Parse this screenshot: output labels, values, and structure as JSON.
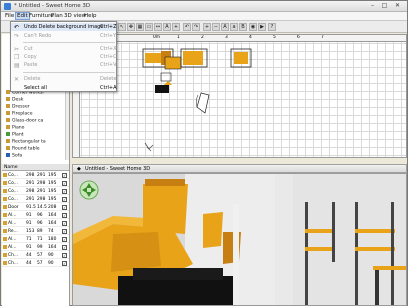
{
  "window": {
    "title": "* Untitled - Sweet Home 3D",
    "min_label": "–",
    "max_label": "□",
    "close_label": "✕"
  },
  "menubar": {
    "items": [
      "File",
      "Edit",
      "Furniture",
      "Plan",
      "3D view",
      "Help"
    ]
  },
  "edit_menu": {
    "items": [
      {
        "label": "Undo Delete background image",
        "shortcut": "Ctrl+Z",
        "enabled": true
      },
      {
        "label": "Can't Redo",
        "shortcut": "Ctrl+Y",
        "enabled": false
      },
      {
        "label": "Cut",
        "shortcut": "Ctrl+X",
        "enabled": false
      },
      {
        "label": "Copy",
        "shortcut": "Ctrl+C",
        "enabled": false
      },
      {
        "label": "Paste",
        "shortcut": "Ctrl+V",
        "enabled": false
      },
      {
        "label": "Delete",
        "shortcut": "Delete",
        "enabled": false
      },
      {
        "label": "Select all",
        "shortcut": "Ctrl+A",
        "enabled": true
      }
    ]
  },
  "catalog": {
    "items": [
      "Corner worksl",
      "Desk",
      "Dresser",
      "Fireplace",
      "Glass-door ca",
      "Piano",
      "Plant",
      "Rectangular ta",
      "Round table",
      "Sofa"
    ]
  },
  "furniture_table": {
    "header": "Name",
    "rows": [
      {
        "name": "Co...",
        "w": "298",
        "d": "291",
        "h": "195"
      },
      {
        "name": "Co...",
        "w": "291",
        "d": "298",
        "h": "195"
      },
      {
        "name": "Co...",
        "w": "298",
        "d": "291",
        "h": "195"
      },
      {
        "name": "Co...",
        "w": "291",
        "d": "298",
        "h": "195"
      },
      {
        "name": "Door",
        "w": "91.5",
        "d": "14.5",
        "h": "208"
      },
      {
        "name": "Al...",
        "w": "91",
        "d": "96",
        "h": "164"
      },
      {
        "name": "Al...",
        "w": "91",
        "d": "96",
        "h": "164"
      },
      {
        "name": "Re...",
        "w": "153",
        "d": "89",
        "h": "74"
      },
      {
        "name": "Al...",
        "w": "71",
        "d": "71",
        "h": "180"
      },
      {
        "name": "Al...",
        "w": "91",
        "d": "99",
        "h": "164"
      },
      {
        "name": "Ch...",
        "w": "44",
        "d": "57",
        "h": "90"
      },
      {
        "name": "Ch...",
        "w": "44",
        "d": "57",
        "h": "90"
      }
    ],
    "check": "✓"
  },
  "plan": {
    "ruler_labels": [
      "0m",
      "1",
      "2",
      "3",
      "4",
      "5",
      "6",
      "7"
    ]
  },
  "view3d": {
    "title": "Untitled - Sweet Home 3D"
  },
  "colors": {
    "wood": "#e8a319",
    "black_furniture": "#111111"
  }
}
